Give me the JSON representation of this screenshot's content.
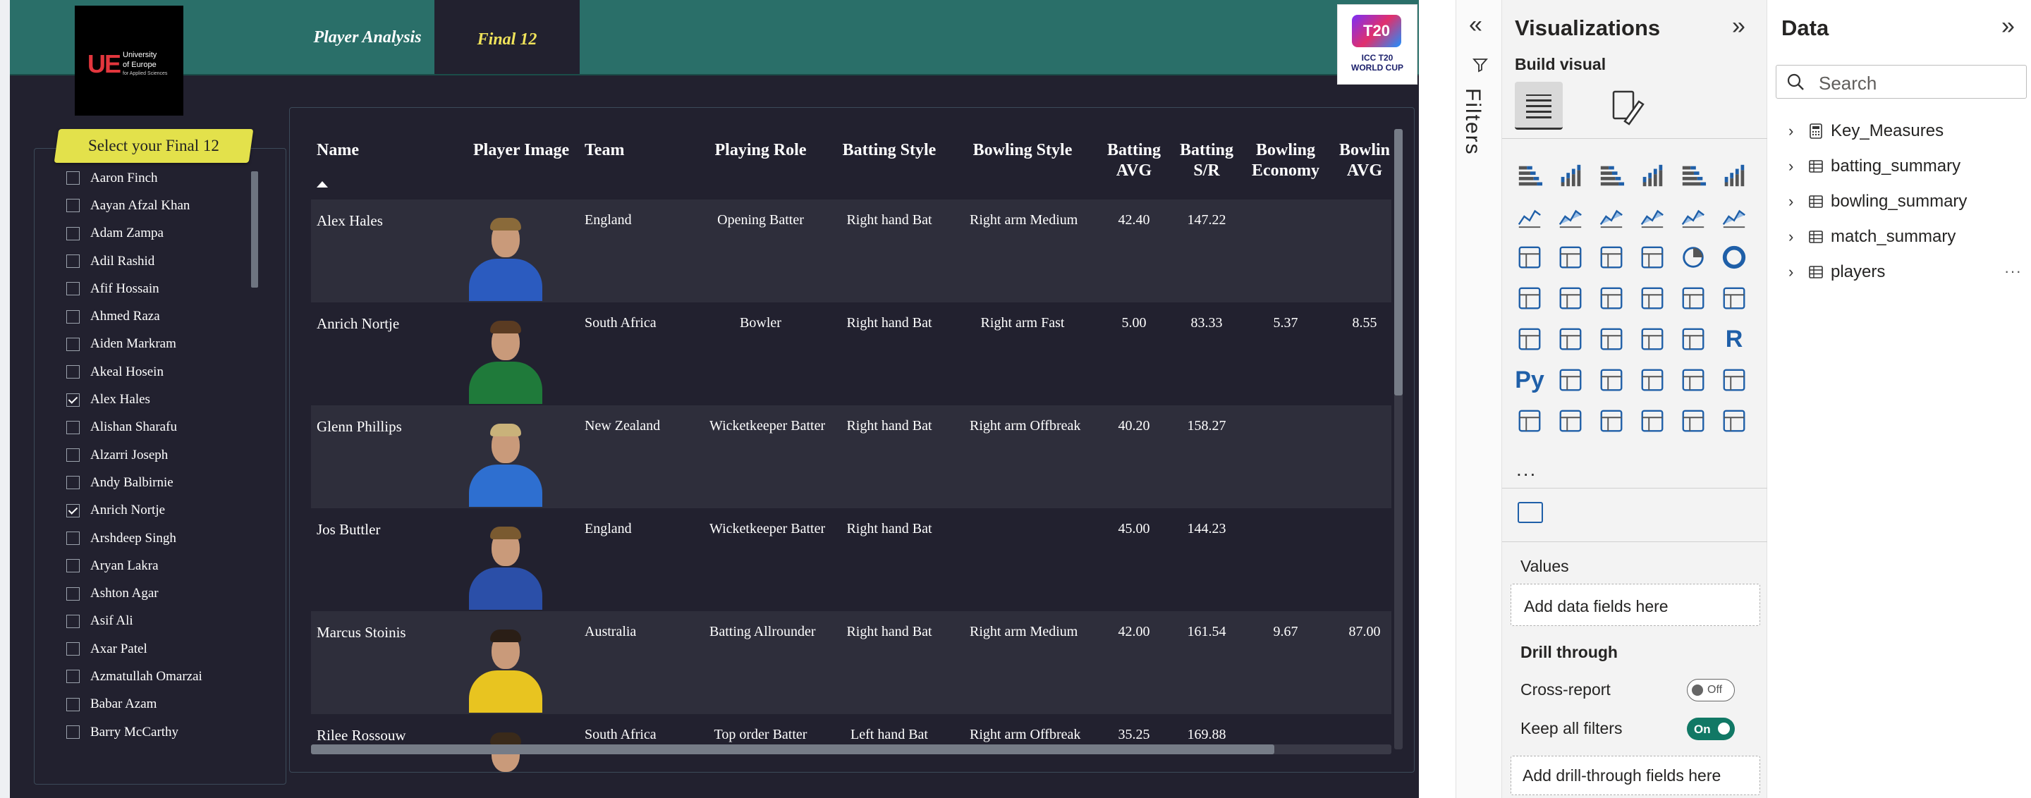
{
  "nav": {
    "tab_player_analysis": "Player Analysis",
    "tab_final12": "Final 12"
  },
  "logos": {
    "university_name_line1": "University",
    "university_name_line2": "of Europe",
    "university_name_line3": "for Applied Sciences",
    "university_mark": "UE",
    "worldcup_badge": "T20",
    "worldcup_line1": "ICC T20",
    "worldcup_line2": "WORLD CUP"
  },
  "slicer": {
    "title": "Select your Final 12",
    "items": [
      {
        "label": "Aaron Finch",
        "checked": false
      },
      {
        "label": "Aayan Afzal Khan",
        "checked": false
      },
      {
        "label": "Adam Zampa",
        "checked": false
      },
      {
        "label": "Adil Rashid",
        "checked": false
      },
      {
        "label": "Afif Hossain",
        "checked": false
      },
      {
        "label": "Ahmed Raza",
        "checked": false
      },
      {
        "label": "Aiden Markram",
        "checked": false
      },
      {
        "label": "Akeal Hosein",
        "checked": false
      },
      {
        "label": "Alex Hales",
        "checked": true
      },
      {
        "label": "Alishan Sharafu",
        "checked": false
      },
      {
        "label": "Alzarri Joseph",
        "checked": false
      },
      {
        "label": "Andy Balbirnie",
        "checked": false
      },
      {
        "label": "Anrich Nortje",
        "checked": true
      },
      {
        "label": "Arshdeep Singh",
        "checked": false
      },
      {
        "label": "Aryan Lakra",
        "checked": false
      },
      {
        "label": "Ashton Agar",
        "checked": false
      },
      {
        "label": "Asif Ali",
        "checked": false
      },
      {
        "label": "Axar Patel",
        "checked": false
      },
      {
        "label": "Azmatullah Omarzai",
        "checked": false
      },
      {
        "label": "Babar Azam",
        "checked": false
      },
      {
        "label": "Barry McCarthy",
        "checked": false
      }
    ]
  },
  "table": {
    "columns": {
      "name": "Name",
      "player_image": "Player Image",
      "team": "Team",
      "playing_role": "Playing Role",
      "batting_style": "Batting Style",
      "bowling_style": "Bowling Style",
      "batting_avg_1": "Batting",
      "batting_avg_2": "AVG",
      "batting_sr_1": "Batting",
      "batting_sr_2": "S/R",
      "bowling_economy_1": "Bowling",
      "bowling_economy_2": "Economy",
      "bowling_avg_1": "Bowlin",
      "bowling_avg_2": "AVG"
    },
    "rows": [
      {
        "name": "Alex Hales",
        "team": "England",
        "role": "Opening Batter",
        "bat_style": "Right hand Bat",
        "bowl_style": "Right arm Medium",
        "bat_avg": "42.40",
        "bat_sr": "147.22",
        "economy": "",
        "bowl_avg": "",
        "kit": "#2b5bbf",
        "hair": "#8a6a3a"
      },
      {
        "name": "Anrich Nortje",
        "team": "South Africa",
        "role": "Bowler",
        "bat_style": "Right hand Bat",
        "bowl_style": "Right arm Fast",
        "bat_avg": "5.00",
        "bat_sr": "83.33",
        "economy": "5.37",
        "bowl_avg": "8.55",
        "kit": "#1f7a3a",
        "hair": "#5a3b22"
      },
      {
        "name": "Glenn Phillips",
        "team": "New Zealand",
        "role": "Wicketkeeper Batter",
        "bat_style": "Right hand Bat",
        "bowl_style": "Right arm Offbreak",
        "bat_avg": "40.20",
        "bat_sr": "158.27",
        "economy": "",
        "bowl_avg": "",
        "kit": "#2e6fd0",
        "hair": "#c9b27a"
      },
      {
        "name": "Jos Buttler",
        "team": "England",
        "role": "Wicketkeeper Batter",
        "bat_style": "Right hand Bat",
        "bowl_style": "",
        "bat_avg": "45.00",
        "bat_sr": "144.23",
        "economy": "",
        "bowl_avg": "",
        "kit": "#2b4fa8",
        "hair": "#7a5a30"
      },
      {
        "name": "Marcus Stoinis",
        "team": "Australia",
        "role": "Batting Allrounder",
        "bat_style": "Right hand Bat",
        "bowl_style": "Right arm Medium",
        "bat_avg": "42.00",
        "bat_sr": "161.54",
        "economy": "9.67",
        "bowl_avg": "87.00",
        "kit": "#e8c420",
        "hair": "#2a1e16"
      },
      {
        "name": "Rilee Rossouw",
        "team": "South Africa",
        "role": "Top order Batter",
        "bat_style": "Left hand Bat",
        "bowl_style": "Right arm Offbreak",
        "bat_avg": "35.25",
        "bat_sr": "169.88",
        "economy": "",
        "bowl_avg": "",
        "kit": "#1f7a3a",
        "hair": "#3a2a1a"
      }
    ]
  },
  "filters_pane": {
    "label": "Filters"
  },
  "visualizations": {
    "title": "Visualizations",
    "build_visual": "Build visual",
    "more": "...",
    "values_label": "Values",
    "values_placeholder": "Add data fields here",
    "drill_through": "Drill through",
    "cross_report": "Cross-report",
    "cross_report_state": "Off",
    "keep_all_filters": "Keep all filters",
    "keep_all_filters_state": "On",
    "drill_placeholder": "Add drill-through fields here",
    "icons": [
      "stacked-bar-icon",
      "stacked-column-icon",
      "clustered-bar-icon",
      "clustered-column-icon",
      "100-stacked-bar-icon",
      "100-stacked-column-icon",
      "line-chart-icon",
      "area-chart-icon",
      "stacked-area-icon",
      "100-stacked-area-icon",
      "line-clustered-column-icon",
      "line-stacked-column-icon",
      "ribbon-chart-icon",
      "waterfall-icon",
      "funnel-icon",
      "scatter-icon",
      "pie-icon",
      "donut-icon",
      "treemap-icon",
      "map-icon",
      "filled-map-icon",
      "azure-map-icon",
      "gauge-icon",
      "card-icon",
      "multi-row-card-icon",
      "kpi-icon",
      "slicer-icon",
      "table-icon",
      "matrix-icon",
      "r-visual-icon",
      "python-visual-icon",
      "key-influencers-icon",
      "decomposition-tree-icon",
      "qa-icon",
      "paginated-report-icon",
      "metrics-icon",
      "power-apps-icon",
      "smart-narrative-icon",
      "power-automate-icon",
      "arcgis-icon",
      "diamond-visual-icon",
      "chevron-visual-icon"
    ],
    "glyphs": {
      "r-visual-icon": "R",
      "python-visual-icon": "Py"
    }
  },
  "data_pane": {
    "title": "Data",
    "search_placeholder": "Search",
    "more": "···",
    "fields": [
      {
        "name": "Key_Measures",
        "icon": "calculator-icon"
      },
      {
        "name": "batting_summary",
        "icon": "table-icon"
      },
      {
        "name": "bowling_summary",
        "icon": "table-icon"
      },
      {
        "name": "match_summary",
        "icon": "table-icon"
      },
      {
        "name": "players",
        "icon": "table-icon"
      }
    ]
  },
  "colors": {
    "canvas_bg": "#22212f",
    "header_bg": "#2a6f69",
    "active_tab_text": "#f0e35a",
    "slicer_title_bg": "#e3e14b",
    "toggle_on": "#117865"
  }
}
